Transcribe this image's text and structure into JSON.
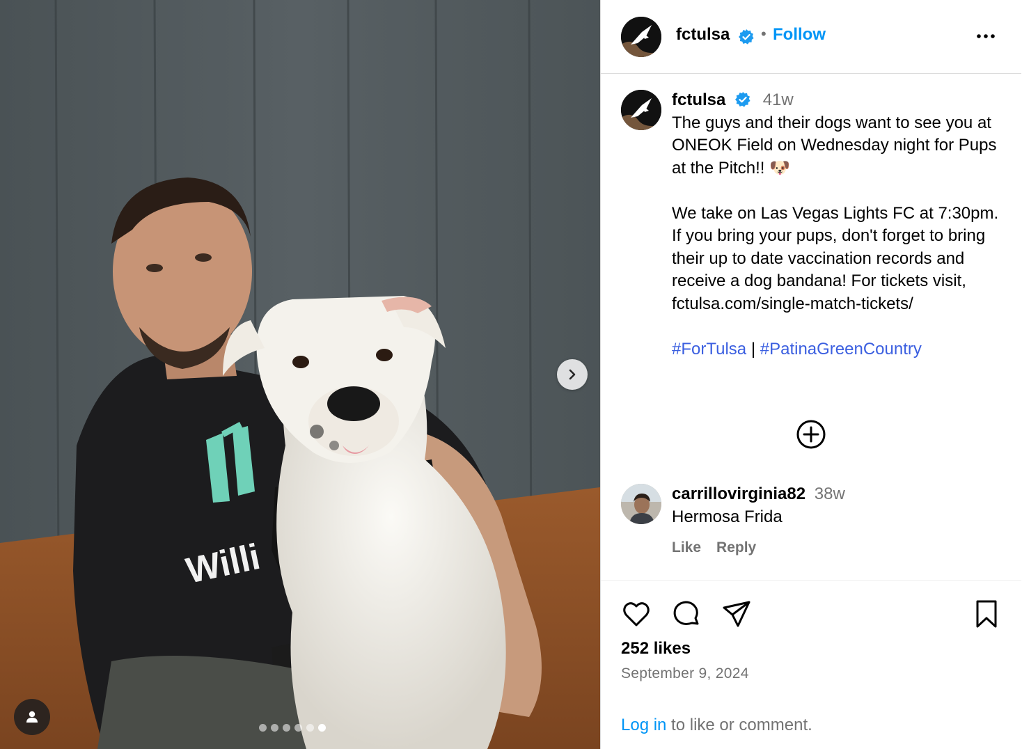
{
  "post": {
    "author": "fctulsa",
    "separator": "•",
    "follow_label": "Follow",
    "more_icon": "more-horizontal-icon",
    "caption": {
      "username": "fctulsa",
      "time": "41w",
      "paragraph1": "The guys and their dogs want to see you at ONEOK Field on Wednesday night for Pups at the Pitch!! 🐶",
      "paragraph2": "We take on Las Vegas Lights FC at 7:30pm. If you bring your pups, don't forget to bring their up to date vaccination records and receive a dog bandana! For tickets visit, fctulsa.com/single-match-tickets/",
      "hashtag1": "#ForTulsa",
      "hashtag_sep": "|",
      "hashtag2": "#PatinaGreenCountry"
    },
    "comments": [
      {
        "username": "carrillovirginia82",
        "time": "38w",
        "text": "Hermosa Frida",
        "like_label": "Like",
        "reply_label": "Reply"
      }
    ],
    "likes": "252 likes",
    "date": "September 9, 2024",
    "login_prompt": {
      "link": "Log in",
      "rest": " to like or comment."
    }
  },
  "media": {
    "slide_count": 6,
    "active_slide": 5,
    "next_icon": "chevron-right-icon",
    "tag_icon": "user-tag-icon"
  },
  "colors": {
    "accent": "#0095f6",
    "hashtag": "#3b5fe0",
    "verified": "#1d9bf0",
    "muted": "#737373"
  }
}
